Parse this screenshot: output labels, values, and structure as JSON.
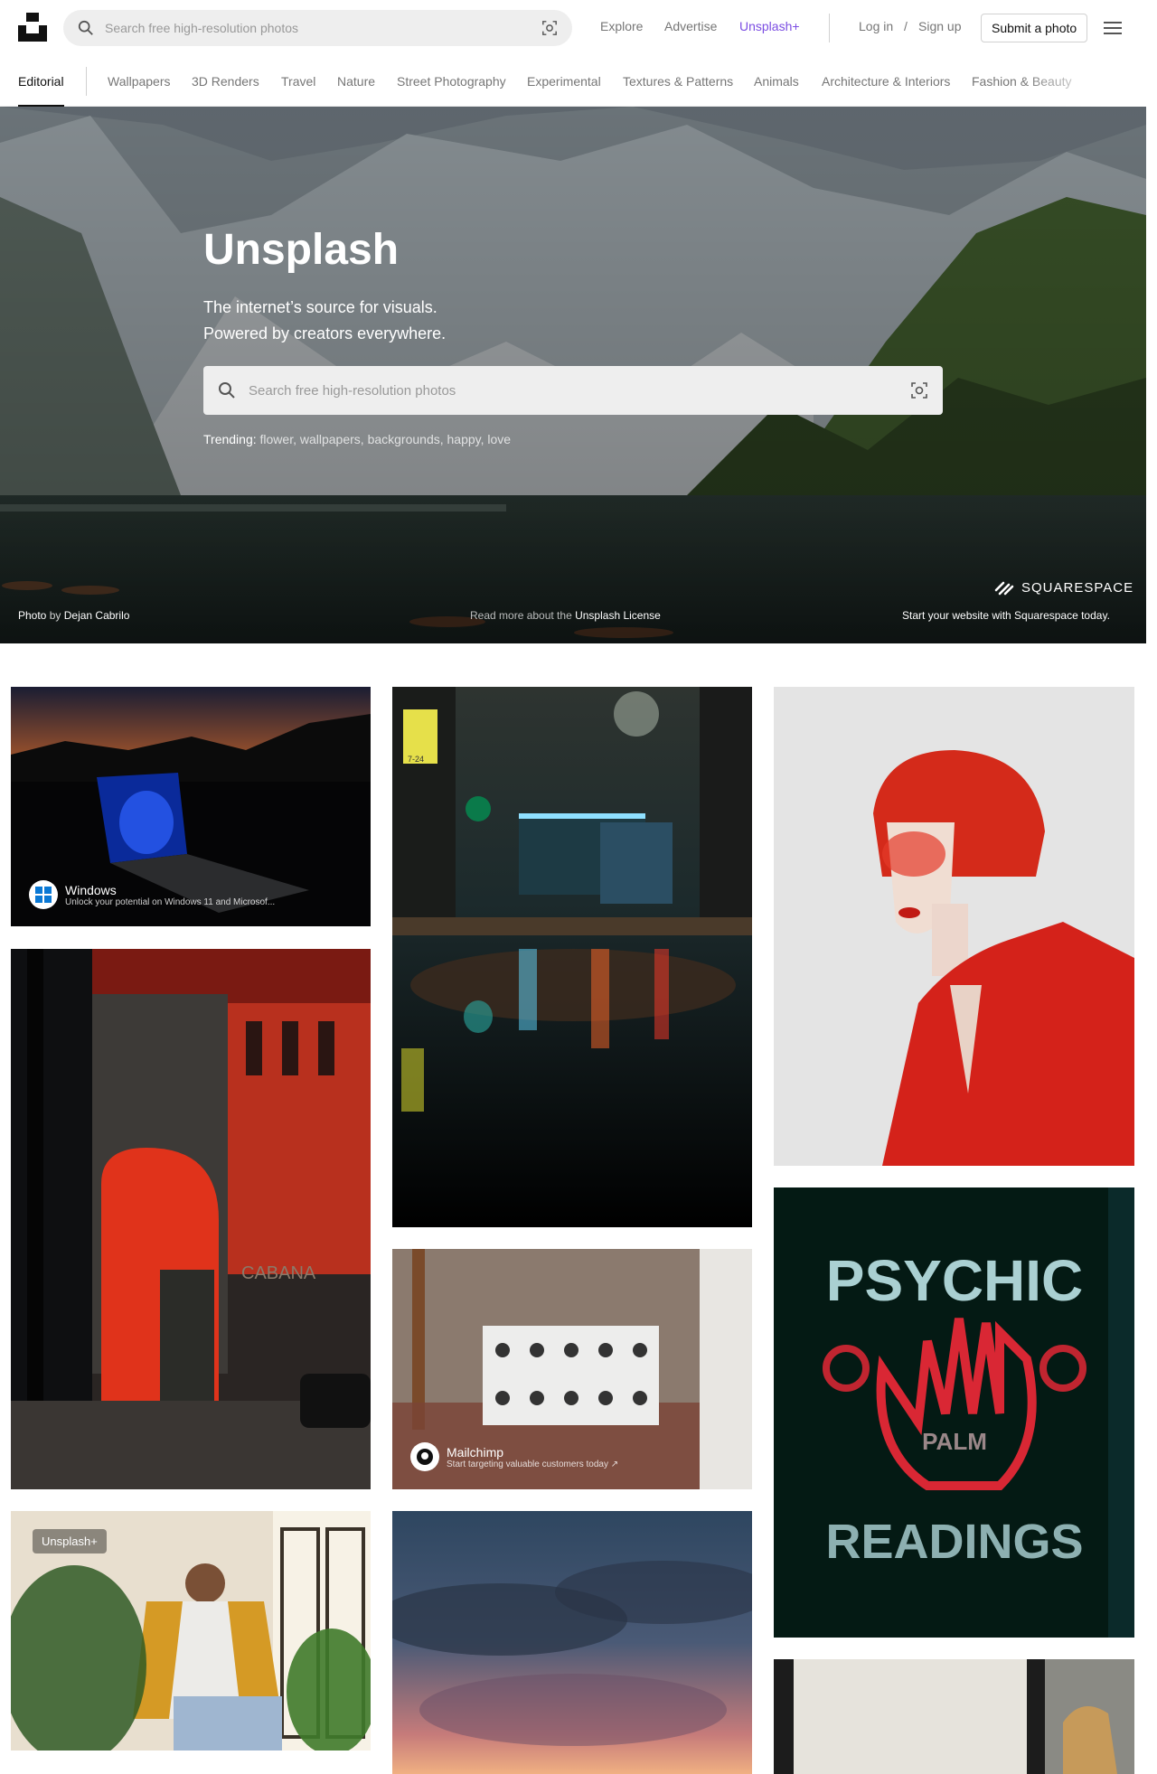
{
  "header": {
    "search_placeholder": "Search free high-resolution photos",
    "nav": [
      "Explore",
      "Advertise",
      "Unsplash+"
    ],
    "login": "Log in",
    "slash": "/",
    "signup": "Sign up",
    "submit": "Submit a photo",
    "accent": "#7b4de2"
  },
  "topics": {
    "active": "Editorial",
    "items": [
      "Wallpapers",
      "3D Renders",
      "Travel",
      "Nature",
      "Street Photography",
      "Experimental",
      "Textures & Patterns",
      "Animals",
      "Architecture & Interiors",
      "Fashion & Beauty"
    ]
  },
  "hero": {
    "title": "Unsplash",
    "sub1": "The internet’s source for visuals.",
    "sub2": "Powered by creators everywhere.",
    "search_placeholder": "Search free high-resolution photos",
    "trending_label": "Trending:",
    "trending_tags": "flower, wallpapers, backgrounds, happy, love",
    "credit_pre": "Photo",
    "credit_by": "by",
    "credit_name": "Dejan Cabrilo",
    "license_pre": "Read more about the",
    "license_link": "Unsplash License",
    "sponsor_name": "SQUARESPACE",
    "sponsor_tag": "Start your website with Squarespace today."
  },
  "grid": {
    "windows_name": "Windows",
    "windows_desc": "Unlock your potential on Windows 11 and Microsof...",
    "mailchimp_name": "Mailchimp",
    "mailchimp_desc": "Start targeting valuable customers today ↗",
    "plus_badge": "Unsplash+",
    "psychic_top": "PSYCHIC",
    "psychic_mid": "PALM",
    "psychic_bottom": "READINGS",
    "cabana": "CABANA",
    "street_sign": "7-24"
  }
}
